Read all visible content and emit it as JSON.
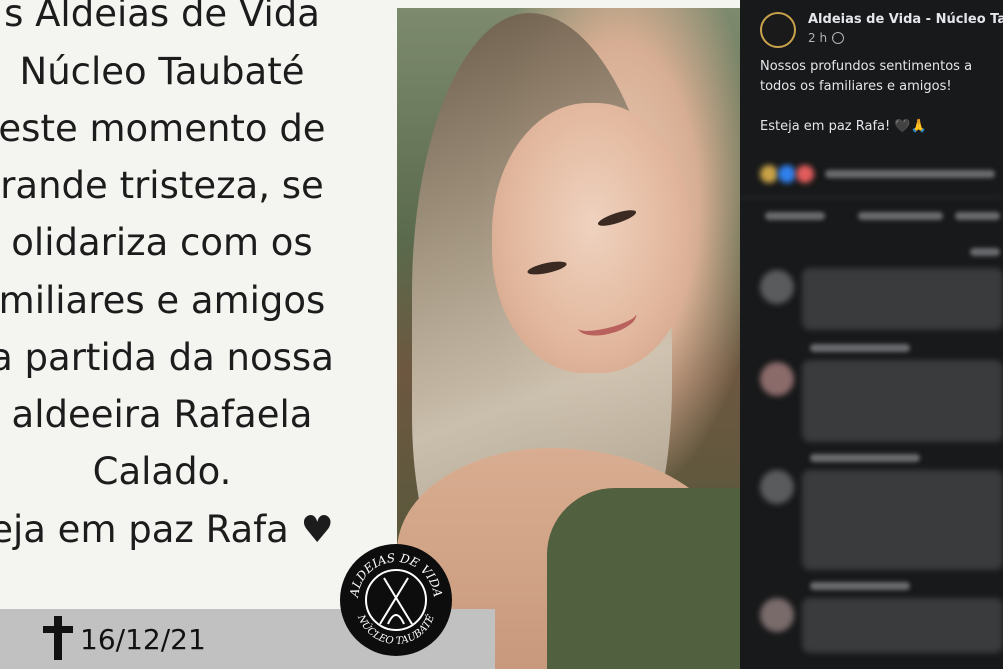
{
  "card": {
    "message_lines": [
      "s Aldeias de Vida",
      "Núcleo Taubaté",
      "este momento de",
      "rande tristeza, se",
      "olidariza com os",
      "miliares e amigos",
      "a partida da nossa",
      "aldeeira Rafaela",
      "Calado.",
      "eja em paz Rafa ♥"
    ],
    "date": "16/12/21",
    "logo_top": "ALDEIAS DE VIDA",
    "logo_bottom": "NÚCLEO TAUBATÉ"
  },
  "post": {
    "page_name": "Aldeias de Vida - Núcleo Taubaté",
    "time": "2 h ·",
    "text_line1": "Nossos profundos sentimentos a todos os familiares e amigos!",
    "text_line2": "Esteja em paz Rafa! 🖤🙏"
  },
  "icons": [
    "cross-icon",
    "globe-icon",
    "heart-icon"
  ]
}
